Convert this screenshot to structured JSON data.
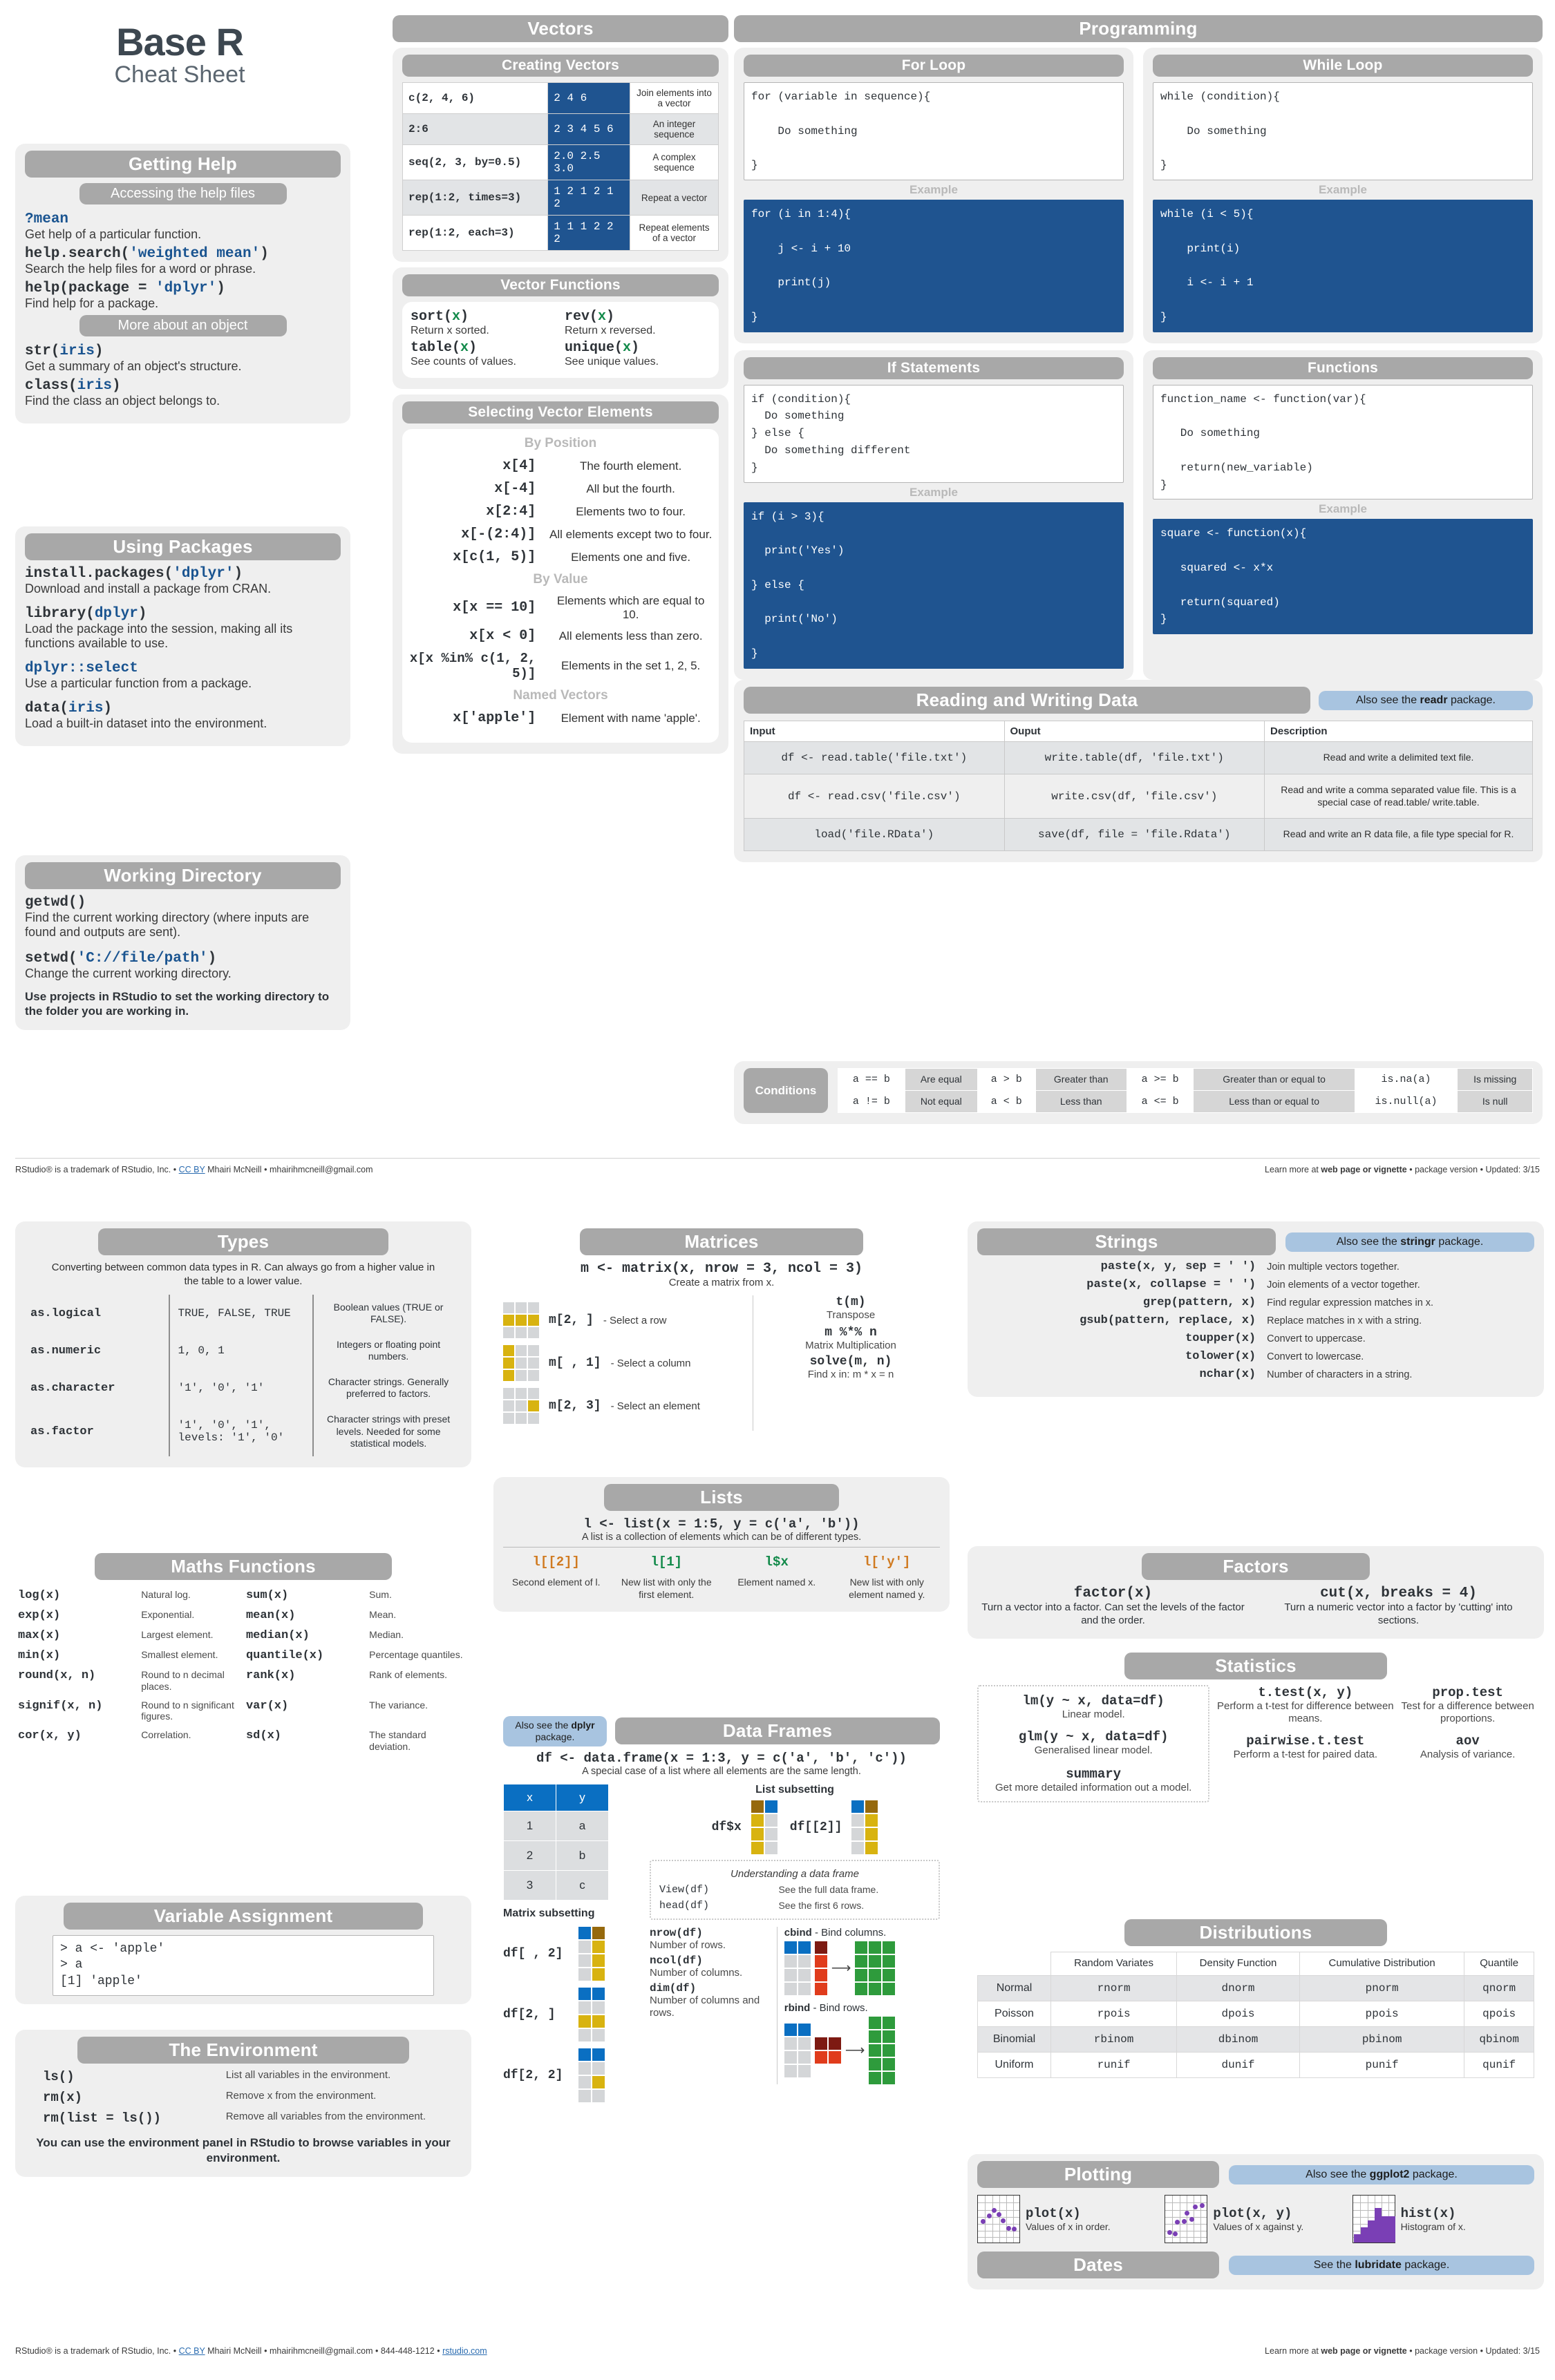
{
  "title": {
    "main": "Base R",
    "sub": "Cheat Sheet"
  },
  "getting_help": {
    "header": "Getting Help",
    "pill_1": "Accessing the help files",
    "pill_2": "More about an object",
    "items_1": [
      {
        "code_a": "?",
        "code_b": "mean",
        "desc": "Get help of a particular function."
      },
      {
        "code_a": "help.search(",
        "code_b": "'weighted mean'",
        "code_c": ")",
        "desc": "Search the help files for a word or phrase."
      },
      {
        "code_a": "help(package = ",
        "code_b": "'dplyr'",
        "code_c": ")",
        "desc": "Find help for a package."
      }
    ],
    "items_2": [
      {
        "code_a": "str(",
        "code_b": "iris",
        "code_c": ")",
        "desc": "Get a summary of an object's structure."
      },
      {
        "code_a": "class(",
        "code_b": "iris",
        "code_c": ")",
        "desc": "Find the class an object belongs to."
      }
    ]
  },
  "using_packages": {
    "header": "Using Packages",
    "items": [
      {
        "code_a": "install.packages(",
        "code_b": "'dplyr'",
        "code_c": ")",
        "desc": "Download and install a package from CRAN."
      },
      {
        "code_a": "library(",
        "code_b": "dplyr",
        "code_c": ")",
        "desc": "Load the package into the session, making all its functions available to use."
      },
      {
        "code_a": "",
        "code_b": "dplyr::select",
        "code_c": "",
        "desc": "Use a particular function from a package."
      },
      {
        "code_a": "data(",
        "code_b": "iris",
        "code_c": ")",
        "desc": "Load a built-in dataset into the environment."
      }
    ]
  },
  "working_directory": {
    "header": "Working Directory",
    "items": [
      {
        "code_a": "getwd()",
        "code_b": "",
        "code_c": "",
        "desc": "Find the current working directory (where inputs are found and outputs are sent)."
      },
      {
        "code_a": "setwd(",
        "code_b": "'C://file/path'",
        "code_c": ")",
        "desc": "Change the current working directory."
      }
    ],
    "note": "Use projects in RStudio to set the working directory to the folder you are working in."
  },
  "vectors": {
    "header": "Vectors",
    "creating": {
      "header": "Creating Vectors",
      "rows": [
        {
          "code": "c(2, 4, 6)",
          "output": "2 4 6",
          "desc": "Join elements into a vector"
        },
        {
          "code": "2:6",
          "output": "2 3 4 5 6",
          "desc": "An integer sequence"
        },
        {
          "code": "seq(2, 3, by=0.5)",
          "output": "2.0 2.5 3.0",
          "desc": "A complex sequence"
        },
        {
          "code": "rep(1:2, times=3)",
          "output": "1 2 1 2 1 2",
          "desc": "Repeat a vector"
        },
        {
          "code": "rep(1:2, each=3)",
          "output": "1 1 1 2 2 2",
          "desc": "Repeat elements of a vector"
        }
      ]
    },
    "functions": {
      "header": "Vector Functions",
      "left": [
        {
          "fn": "sort(",
          "arg": "x",
          "close": ")",
          "desc": "Return x sorted."
        },
        {
          "fn": "table(",
          "arg": "x",
          "close": ")",
          "desc": "See counts of values."
        }
      ],
      "right": [
        {
          "fn": "rev(",
          "arg": "x",
          "close": ")",
          "desc": "Return x reversed."
        },
        {
          "fn": "unique(",
          "arg": "x",
          "close": ")",
          "desc": "See unique values."
        }
      ]
    },
    "selecting": {
      "header": "Selecting Vector Elements",
      "group_position": "By Position",
      "group_value": "By Value",
      "group_named": "Named Vectors",
      "by_position": [
        {
          "code": "x[4]",
          "desc": "The fourth element."
        },
        {
          "code": "x[-4]",
          "desc": "All but the fourth."
        },
        {
          "code": "x[2:4]",
          "desc": "Elements two to four."
        },
        {
          "code": "x[-(2:4)]",
          "desc": "All elements except two to four."
        },
        {
          "code": "x[c(1, 5)]",
          "desc": "Elements one and five."
        }
      ],
      "by_value": [
        {
          "code": "x[x == 10]",
          "desc": "Elements which are equal to 10."
        },
        {
          "code": "x[x < 0]",
          "desc": "All elements less than zero."
        },
        {
          "code": "x[x %in% c(1, 2, 5)]",
          "desc": "Elements in the set 1, 2, 5."
        }
      ],
      "named": [
        {
          "code": "x['apple']",
          "desc": "Element with name 'apple'."
        }
      ]
    }
  },
  "programming": {
    "header": "Programming",
    "example_label": "Example",
    "for_loop": {
      "header": "For Loop",
      "template": "for (variable in sequence){\n\n    Do something\n\n}",
      "example": "for (i in 1:4){\n\n    j <- i + 10\n\n    print(j)\n\n}"
    },
    "while_loop": {
      "header": "While Loop",
      "template": "while (condition){\n\n    Do something\n\n}",
      "example": "while (i < 5){\n\n    print(i)\n\n    i <- i + 1\n\n}"
    },
    "if_statements": {
      "header": "If Statements",
      "template": "if (condition){\n  Do something\n} else {\n  Do something different\n}",
      "example": "if (i > 3){\n\n  print('Yes')\n\n} else {\n\n  print('No')\n\n}"
    },
    "functions": {
      "header": "Functions",
      "template": "function_name <- function(var){\n\n   Do something\n\n   return(new_variable)\n}",
      "example": "square <- function(x){\n\n   squared <- x*x\n\n   return(squared)\n}"
    }
  },
  "reading_writing": {
    "header": "Reading and Writing Data",
    "note": "Also see the readr package.",
    "note_bold": "readr",
    "columns": [
      "Input",
      "Ouput",
      "Description"
    ],
    "rows": [
      {
        "input": "df <- read.table('file.txt')",
        "output": "write.table(df, 'file.txt')",
        "desc": "Read and write a delimited text file."
      },
      {
        "input": "df <- read.csv('file.csv')",
        "output": "write.csv(df, 'file.csv')",
        "desc": "Read and write a comma separated value file. This is a special case of read.table/ write.table."
      },
      {
        "input": "load('file.RData')",
        "output": "save(df, file = 'file.Rdata')",
        "desc": "Read and write an R data file, a file type special for R."
      }
    ]
  },
  "conditions": {
    "label": "Conditions",
    "row1": [
      {
        "op": "a == b",
        "txt": "Are equal"
      },
      {
        "op": "a > b",
        "txt": "Greater than"
      },
      {
        "op": "a >= b",
        "txt": "Greater than or equal to"
      },
      {
        "op": "is.na(a)",
        "txt": "Is missing"
      }
    ],
    "row2": [
      {
        "op": "a != b",
        "txt": "Not equal"
      },
      {
        "op": "a < b",
        "txt": "Less than"
      },
      {
        "op": "a <= b",
        "txt": "Less than or equal to"
      },
      {
        "op": "is.null(a)",
        "txt": "Is null"
      }
    ]
  },
  "types": {
    "header": "Types",
    "intro": "Converting between common data types in R. Can always go from a higher value in the table to a lower value.",
    "rows": [
      {
        "name": "as.logical",
        "value": "TRUE, FALSE, TRUE",
        "desc": "Boolean values (TRUE or FALSE)."
      },
      {
        "name": "as.numeric",
        "value": "1, 0, 1",
        "desc": "Integers or floating point numbers."
      },
      {
        "name": "as.character",
        "value": "'1', '0', '1'",
        "desc": "Character strings. Generally preferred to factors."
      },
      {
        "name": "as.factor",
        "value": "'1', '0', '1',\nlevels: '1', '0'",
        "desc": "Character strings with preset levels. Needed for some statistical models."
      }
    ]
  },
  "maths": {
    "header": "Maths Functions",
    "rows": [
      {
        "l_fn": "log(x)",
        "l_d": "Natural log.",
        "r_fn": "sum(x)",
        "r_d": "Sum."
      },
      {
        "l_fn": "exp(x)",
        "l_d": "Exponential.",
        "r_fn": "mean(x)",
        "r_d": "Mean."
      },
      {
        "l_fn": "max(x)",
        "l_d": "Largest element.",
        "r_fn": "median(x)",
        "r_d": "Median."
      },
      {
        "l_fn": "min(x)",
        "l_d": "Smallest element.",
        "r_fn": "quantile(x)",
        "r_d": "Percentage quantiles."
      },
      {
        "l_fn": "round(x, n)",
        "l_d": "Round to n decimal places.",
        "r_fn": "rank(x)",
        "r_d": "Rank of elements."
      },
      {
        "l_fn": "signif(x, n)",
        "l_d": "Round to n significant figures.",
        "r_fn": "var(x)",
        "r_d": "The variance."
      },
      {
        "l_fn": "cor(x, y)",
        "l_d": "Correlation.",
        "r_fn": "sd(x)",
        "r_d": "The standard deviation."
      }
    ]
  },
  "variable_assignment": {
    "header": "Variable Assignment",
    "code": "> a <- 'apple'\n> a\n[1] 'apple'"
  },
  "environment": {
    "header": "The Environment",
    "rows": [
      {
        "code": "ls()",
        "desc": "List all variables in the environment."
      },
      {
        "code": "rm(x)",
        "desc": "Remove x from the environment."
      },
      {
        "code": "rm(list = ls())",
        "desc": "Remove all variables from the environment."
      }
    ],
    "note": "You can use the environment panel in RStudio to browse variables in your environment."
  },
  "matrices": {
    "header": "Matrices",
    "create_code": "m <- matrix(x, nrow = 3, ncol = 3)",
    "create_desc": "Create a matrix from x.",
    "rows": [
      {
        "code": "m[2,  ]",
        "text": "- Select a row"
      },
      {
        "code": "m[ , 1]",
        "text": "- Select a  column"
      },
      {
        "code": "m[2, 3]",
        "text": "- Select an element"
      }
    ],
    "right": [
      {
        "code": "t(m)",
        "desc": "Transpose"
      },
      {
        "code": "m %*% n",
        "desc": "Matrix Multiplication"
      },
      {
        "code": "solve(m, n)",
        "desc": "Find x in: m * x = n"
      }
    ]
  },
  "lists": {
    "header": "Lists",
    "create_code": "l <- list(x = 1:5, y = c('a', 'b'))",
    "create_desc": "A list is a collection of elements which can be of different types.",
    "items": [
      {
        "code": "l[[2]]",
        "desc": "Second element of l."
      },
      {
        "code": "l[1]",
        "desc": "New list with only the first element."
      },
      {
        "code": "l$x",
        "desc": "Element named x."
      },
      {
        "code": "l['y']",
        "desc": "New list with only element named y."
      }
    ]
  },
  "data_frames": {
    "header": "Data Frames",
    "note": "Also see the dplyr package.",
    "note_bold": "dplyr",
    "create_code": "df <- data.frame(x = 1:3, y = c('a', 'b', 'c'))",
    "create_desc": "A special case of a list where all elements are the same length.",
    "table": {
      "columns": [
        "x",
        "y"
      ],
      "rows": [
        [
          "1",
          "a"
        ],
        [
          "2",
          "b"
        ],
        [
          "3",
          "c"
        ]
      ]
    },
    "list_subsetting_label": "List subsetting",
    "matrix_subsetting_label": "Matrix subsetting",
    "list_subsetting": [
      {
        "code": "df$x"
      },
      {
        "code": "df[[2]]"
      }
    ],
    "matrix_subsetting": [
      {
        "code": "df[ , 2]"
      },
      {
        "code": "df[2, ]"
      },
      {
        "code": "df[2, 2]"
      }
    ],
    "understanding_label": "Understanding a data frame",
    "understanding": [
      {
        "code": "View(df)",
        "desc": "See the full data frame."
      },
      {
        "code": "head(df)",
        "desc": "See the first 6 rows."
      }
    ],
    "dims": [
      {
        "code": "nrow(df)",
        "desc": "Number of rows."
      },
      {
        "code": "ncol(df)",
        "desc": "Number of columns."
      },
      {
        "code": "dim(df)",
        "desc": "Number of columns and rows."
      }
    ],
    "binds": [
      {
        "name": "cbind",
        "desc": "- Bind columns."
      },
      {
        "name": "rbind",
        "desc": "- Bind rows."
      }
    ]
  },
  "strings": {
    "header": "Strings",
    "note": "Also see the stringr package.",
    "note_bold": "stringr",
    "rows": [
      {
        "fn": "paste(x, y, sep = ' ')",
        "desc": "Join multiple vectors together."
      },
      {
        "fn": "paste(x, collapse = ' ')",
        "desc": "Join elements of a vector together."
      },
      {
        "fn": "grep(pattern, x)",
        "desc": "Find regular expression matches in x."
      },
      {
        "fn": "gsub(pattern, replace, x)",
        "desc": "Replace matches in x with a string."
      },
      {
        "fn": "toupper(x)",
        "desc": "Convert to uppercase."
      },
      {
        "fn": "tolower(x)",
        "desc": "Convert to lowercase."
      },
      {
        "fn": "nchar(x)",
        "desc": "Number of characters in a string."
      }
    ]
  },
  "factors": {
    "header": "Factors",
    "items": [
      {
        "code": "factor(x)",
        "desc": "Turn a vector into a factor. Can set the levels of the factor and the order."
      },
      {
        "code": "cut(x, breaks = 4)",
        "desc": "Turn a numeric vector into a factor by 'cutting' into sections."
      }
    ]
  },
  "statistics": {
    "header": "Statistics",
    "boxed": [
      {
        "code": "lm(y ~ x, data=df)",
        "desc": "Linear model."
      },
      {
        "code": "glm(y ~ x, data=df)",
        "desc": "Generalised linear model."
      },
      {
        "code": "summary",
        "desc": "Get more detailed information out a model."
      }
    ],
    "mid": [
      {
        "code": "t.test(x, y)",
        "desc": "Perform a t-test for difference between means."
      },
      {
        "code": "pairwise.t.test",
        "desc": "Perform a t-test for paired data."
      }
    ],
    "right": [
      {
        "code": "prop.test",
        "desc": "Test for a difference between proportions."
      },
      {
        "code": "aov",
        "desc": "Analysis of variance."
      }
    ]
  },
  "distributions": {
    "header": "Distributions",
    "columns": [
      "",
      "Random Variates",
      "Density Function",
      "Cumulative Distribution",
      "Quantile"
    ],
    "rows": [
      [
        "Normal",
        "rnorm",
        "dnorm",
        "pnorm",
        "qnorm"
      ],
      [
        "Poisson",
        "rpois",
        "dpois",
        "ppois",
        "qpois"
      ],
      [
        "Binomial",
        "rbinom",
        "dbinom",
        "pbinom",
        "qbinom"
      ],
      [
        "Uniform",
        "runif",
        "dunif",
        "punif",
        "qunif"
      ]
    ]
  },
  "plotting": {
    "header": "Plotting",
    "note": "Also see the ggplot2 package.",
    "note_bold": "ggplot2",
    "items": [
      {
        "code": "plot(x)",
        "desc": "Values of x in order."
      },
      {
        "code": "plot(x, y)",
        "desc": "Values of x against y."
      },
      {
        "code": "hist(x)",
        "desc": "Histogram of x."
      }
    ]
  },
  "dates": {
    "header": "Dates",
    "note": "See the lubridate package.",
    "note_bold": "lubridate"
  },
  "footer": {
    "trademark": "RStudio® is a trademark of RStudio, Inc.",
    "sep": "•",
    "cc": "CC BY",
    "author": "Mhairi McNeill",
    "email": "mhairihmcneill@gmail.com",
    "phone": "844-448-1212",
    "site": "rstudio.com",
    "learn": "Learn more at",
    "learn_bold": "web page or vignette",
    "version": "package  version",
    "updated": "Updated: 3/15"
  }
}
